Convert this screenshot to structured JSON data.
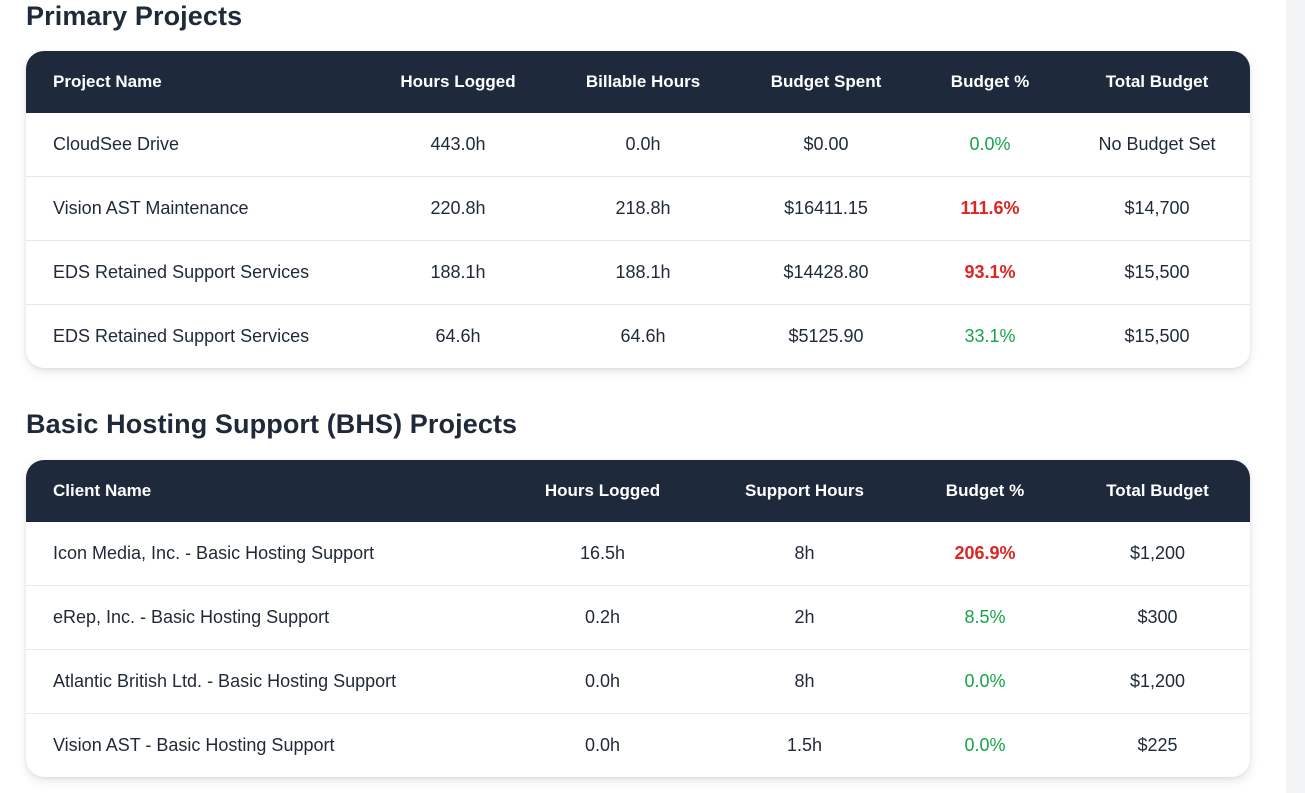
{
  "primary": {
    "title": "Primary Projects",
    "headers": [
      "Project Name",
      "Hours Logged",
      "Billable Hours",
      "Budget Spent",
      "Budget %",
      "Total Budget"
    ],
    "rows": [
      {
        "name": "CloudSee Drive",
        "hours": "443.0h",
        "billable": "0.0h",
        "spent": "$0.00",
        "pct": "0.0%",
        "pct_status": "ok",
        "total": "No Budget Set"
      },
      {
        "name": "Vision AST Maintenance",
        "hours": "220.8h",
        "billable": "218.8h",
        "spent": "$16411.15",
        "pct": "111.6%",
        "pct_status": "over",
        "total": "$14,700"
      },
      {
        "name": "EDS Retained Support Services",
        "hours": "188.1h",
        "billable": "188.1h",
        "spent": "$14428.80",
        "pct": "93.1%",
        "pct_status": "over",
        "total": "$15,500"
      },
      {
        "name": "EDS Retained Support Services",
        "hours": "64.6h",
        "billable": "64.6h",
        "spent": "$5125.90",
        "pct": "33.1%",
        "pct_status": "ok",
        "total": "$15,500"
      }
    ]
  },
  "bhs": {
    "title": "Basic Hosting Support (BHS) Projects",
    "headers": [
      "Client Name",
      "Hours Logged",
      "Support Hours",
      "Budget %",
      "Total Budget"
    ],
    "rows": [
      {
        "name": "Icon Media, Inc. - Basic Hosting Support",
        "hours": "16.5h",
        "support": "8h",
        "pct": "206.9%",
        "pct_status": "over",
        "total": "$1,200"
      },
      {
        "name": "eRep, Inc. - Basic Hosting Support",
        "hours": "0.2h",
        "support": "2h",
        "pct": "8.5%",
        "pct_status": "ok",
        "total": "$300"
      },
      {
        "name": "Atlantic British Ltd. - Basic Hosting Support",
        "hours": "0.0h",
        "support": "8h",
        "pct": "0.0%",
        "pct_status": "ok",
        "total": "$1,200"
      },
      {
        "name": "Vision AST - Basic Hosting Support",
        "hours": "0.0h",
        "support": "1.5h",
        "pct": "0.0%",
        "pct_status": "ok",
        "total": "$225"
      }
    ]
  },
  "colors": {
    "header_bg": "#1e293b",
    "ok": "#16a34a",
    "over": "#dc2626"
  }
}
